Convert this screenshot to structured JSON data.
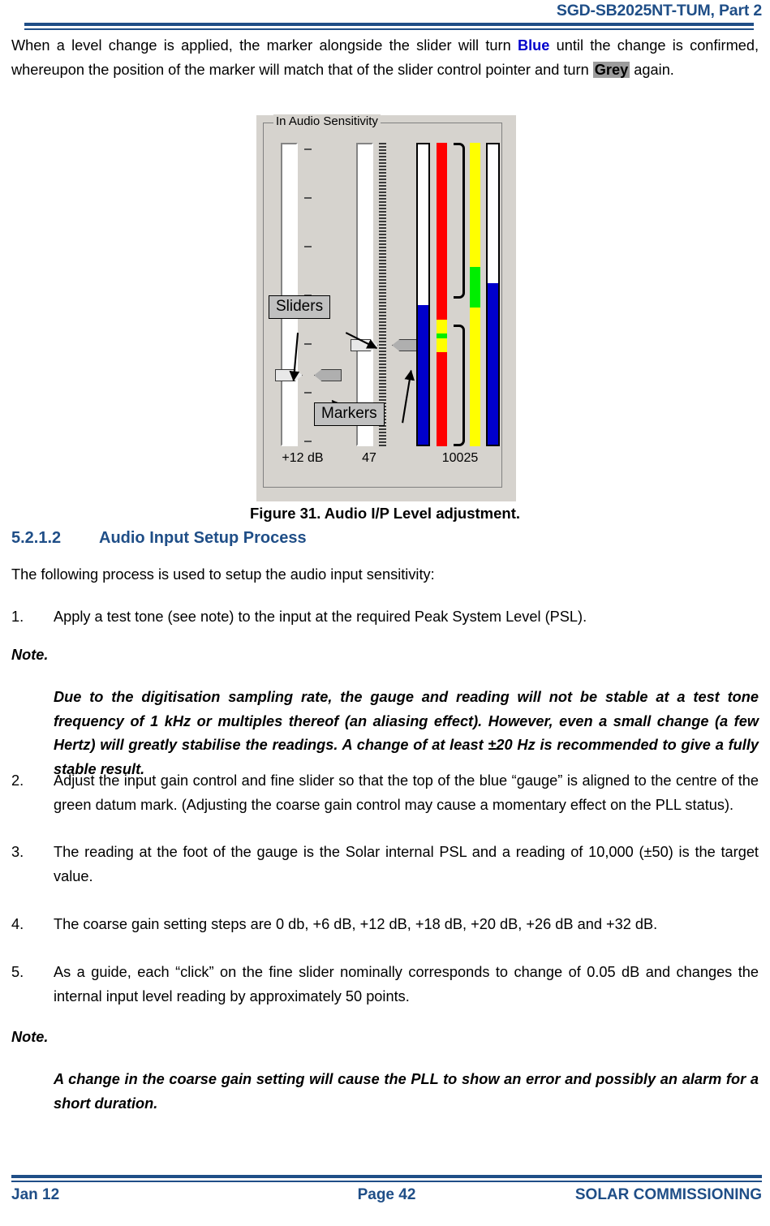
{
  "header": {
    "title": "SGD-SB2025NT-TUM, Part 2"
  },
  "intro": {
    "part1": "When a level change is applied, the marker alongside the slider will turn ",
    "blue_word": "Blue",
    "part2": " until the change is confirmed, whereupon the position of the marker will match that of the slider control pointer and turn ",
    "grey_word": "Grey",
    "part3": " again."
  },
  "figure": {
    "group_title": "In Audio Sensitivity",
    "callout_sliders": "Sliders",
    "callout_markers": "Markers",
    "label_coarse": "+12 dB",
    "label_fine": "47",
    "label_reading": "10025",
    "colors": {
      "panel": "#D6D3CE",
      "gauge_blue": "#0000CC",
      "scale_red": "#FF0000",
      "scale_yellow": "#FFFF00",
      "datum_green": "#00EE00",
      "callout_grey": "#C0C0C0"
    }
  },
  "figure_caption": "Figure 31.  Audio I/P Level adjustment.",
  "section": {
    "number": "5.2.1.2",
    "title": "Audio Input Setup Process"
  },
  "lead_in": "The following process is used to setup the audio input sensitivity:",
  "steps": [
    {
      "num": "1.",
      "text": "Apply a test tone (see note) to the input at the required Peak System Level (PSL)."
    },
    {
      "num": "2.",
      "text": "Adjust the input gain control and fine slider so that the top of the blue “gauge” is aligned to the centre of the green datum mark.  (Adjusting the coarse gain control may cause a momentary effect on the PLL status)."
    },
    {
      "num": "3.",
      "text": "The reading at the foot of the gauge is the Solar internal PSL and a reading of 10,000 (±50) is the target value."
    },
    {
      "num": "4.",
      "text": "The coarse gain setting steps are 0 db, +6 dB, +12 dB, +18 dB, +20 dB, +26 dB and +32 dB."
    },
    {
      "num": "5.",
      "text": "As a guide, each “click” on the fine slider nominally corresponds to change of 0.05 dB and changes the internal input level reading by approximately 50 points."
    }
  ],
  "notes": [
    {
      "label": "Note.",
      "body": "Due to the digitisation sampling rate, the gauge and reading will not be stable at a test tone frequency of 1 kHz or multiples thereof (an aliasing effect).  However, even a small change (a few Hertz) will greatly stabilise the readings.  A change of at least ±20 Hz is recommended to give a fully stable result."
    },
    {
      "label": "Note.",
      "body": "A change in the coarse gain setting will cause the PLL to show an error and possibly an alarm for a short duration."
    }
  ],
  "footer": {
    "date": "Jan 12",
    "page": "Page 42",
    "company": "SOLAR COMMISSIONING"
  }
}
